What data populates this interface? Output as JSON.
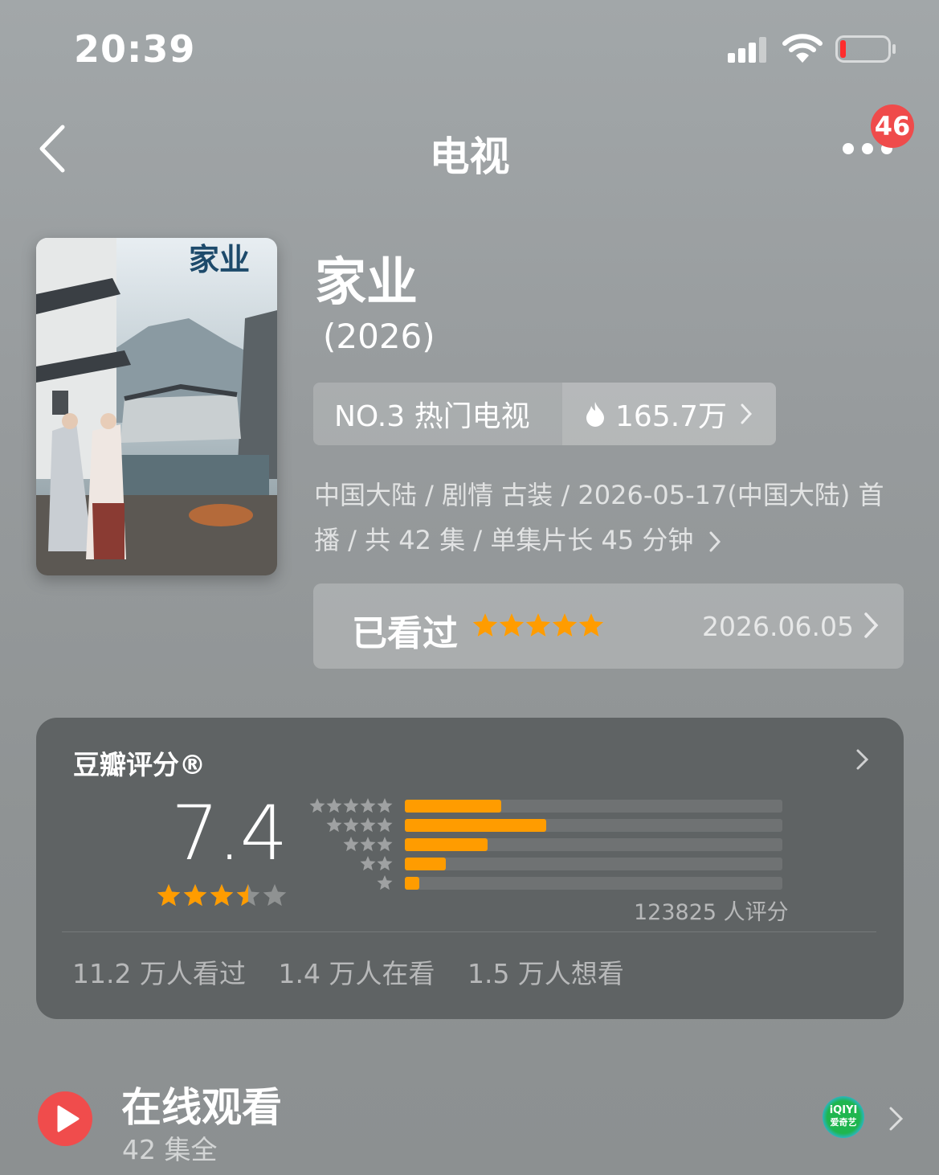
{
  "status_bar": {
    "time": "20:39"
  },
  "nav": {
    "title": "电视",
    "badge_count": "46"
  },
  "poster": {
    "text": "家业"
  },
  "show": {
    "title": "家业",
    "year": "(2026)",
    "rank_label": "NO.3 热门电视",
    "heat": "165.7万",
    "meta": "中国大陆 / 剧情 古装 / 2026-05-17(中国大陆) 首播 / 共 42 集 / 单集片长 45 分钟"
  },
  "watched": {
    "label": "已看过",
    "my_stars": 5,
    "date": "2026.06.05"
  },
  "rating": {
    "title": "豆瓣评分®",
    "score": "7.4",
    "score_stars": 3.5,
    "distribution": [
      {
        "stars": 5,
        "fraction": 0.255
      },
      {
        "stars": 4,
        "fraction": 0.375
      },
      {
        "stars": 3,
        "fraction": 0.22
      },
      {
        "stars": 2,
        "fraction": 0.108
      },
      {
        "stars": 1,
        "fraction": 0.038
      }
    ],
    "raters": "123825 人评分",
    "stats": [
      "11.2 万人看过",
      "1.4 万人在看",
      "1.5 万人想看"
    ]
  },
  "online": {
    "title": "在线观看",
    "subtitle": "42 集全",
    "provider_text_1": "iQIYI",
    "provider_text_2": "爱奇艺"
  },
  "colors": {
    "accent_orange": "#ff9c00",
    "play_red": "#f04c4c",
    "badge_red": "#ef4b4b"
  }
}
